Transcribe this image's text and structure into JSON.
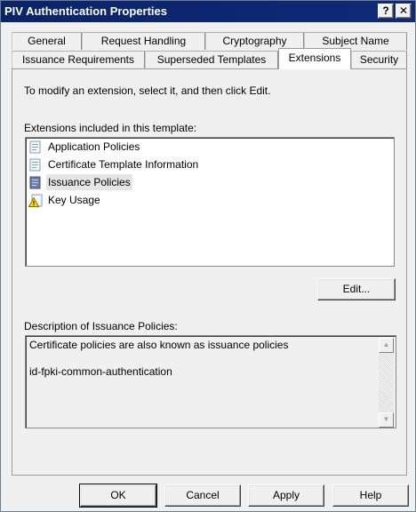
{
  "window": {
    "title": "PIV Authentication Properties",
    "help_label": "?",
    "close_label": "✕"
  },
  "tabs": {
    "row1": [
      "General",
      "Request Handling",
      "Cryptography",
      "Subject Name"
    ],
    "row2": [
      "Issuance Requirements",
      "Superseded Templates",
      "Extensions",
      "Security"
    ],
    "active": "Extensions"
  },
  "extensions_tab": {
    "instruction": "To modify an extension, select it, and then click Edit.",
    "list_label": "Extensions included in this template:",
    "items": [
      {
        "label": "Application Policies",
        "icon": "extension-doc-icon"
      },
      {
        "label": "Certificate Template Information",
        "icon": "extension-doc-icon"
      },
      {
        "label": "Issuance Policies",
        "icon": "extension-doc-icon",
        "selected": true
      },
      {
        "label": "Key Usage",
        "icon": "warning-extension-icon"
      }
    ],
    "edit_button": "Edit...",
    "description_label": "Description of Issuance Policies:",
    "description_lines": [
      "Certificate policies are also known as issuance policies",
      "id-fpki-common-authentication"
    ]
  },
  "footer": {
    "ok": "OK",
    "cancel": "Cancel",
    "apply": "Apply",
    "help": "Help"
  }
}
